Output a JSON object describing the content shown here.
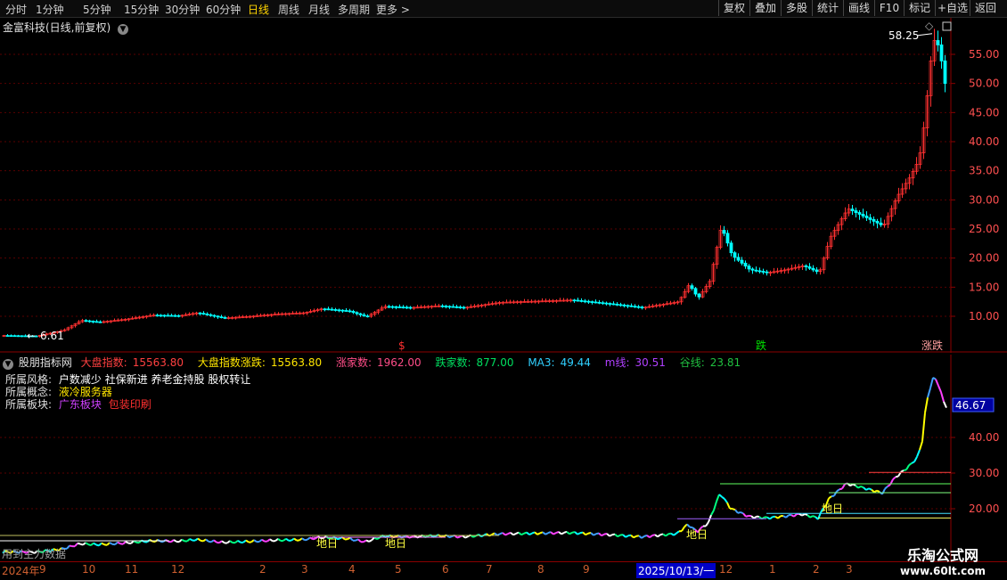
{
  "toolbar": {
    "periods": [
      "分时",
      "1分钟",
      "5分钟",
      "15分钟",
      "30分钟",
      "60分钟",
      "日线",
      "周线",
      "月线",
      "多周期",
      "更多 >"
    ],
    "active_period": "日线",
    "buttons": [
      "复权",
      "叠加",
      "多股",
      "统计",
      "画线",
      "F10",
      "标记",
      "+自选",
      "返回"
    ]
  },
  "main": {
    "stock_title": "金富科技(日线,前复权)",
    "y_ticks": [
      "55.00",
      "50.00",
      "45.00",
      "40.00",
      "35.00",
      "30.00",
      "25.00",
      "20.00",
      "15.00",
      "10.00"
    ],
    "high_label": "58.25",
    "low_label": "6.61",
    "markers": [
      {
        "text": "跌",
        "color": "#00e000"
      },
      {
        "text": "涨",
        "color": "#ff3030"
      },
      {
        "text": "涨跌",
        "color": "#ffa0a0"
      }
    ]
  },
  "indicator": {
    "name": "股朋指标网",
    "fields": [
      {
        "label": "大盘指数:",
        "value": "15563.80",
        "color": "#ff4040"
      },
      {
        "label": "大盘指数涨跌:",
        "value": "15563.80",
        "color": "#ffe600"
      },
      {
        "label": "涨家数:",
        "value": "1962.00",
        "color": "#ff4d88"
      },
      {
        "label": "跌家数:",
        "value": "877.00",
        "color": "#00e060"
      },
      {
        "label": "MA3:",
        "value": "49.44",
        "color": "#30d0ff"
      },
      {
        "label": "m线:",
        "value": "30.51",
        "color": "#b040ff"
      },
      {
        "label": "谷线:",
        "value": "23.81",
        "color": "#20c040"
      }
    ],
    "style_label": "所属风格:",
    "style_value": "户数减少 社保新进 养老金持股 股权转让",
    "concept_label": "所属概念:",
    "concept_value": "液冷服务器",
    "sector_label": "所属板块:",
    "sector_values": [
      "广东板块",
      "包装印刷"
    ],
    "y_ticks": [
      "40.00",
      "30.00",
      "20.00"
    ],
    "current_value": "46.67",
    "bottom_note": "用到主力数据",
    "tag": "地日"
  },
  "date_axis": {
    "labels": [
      "2024年",
      "9",
      "10",
      "11",
      "12",
      "2",
      "3",
      "4",
      "5",
      "6",
      "7",
      "8",
      "9",
      "12",
      "1",
      "2",
      "3"
    ],
    "cursor": "2025/10/13/一"
  },
  "watermark": {
    "line1": "乐淘公式网",
    "line2": "www.60lt.com"
  },
  "colors": {
    "up": "#ff3030",
    "down": "#00ffff",
    "grid": "#5a0000",
    "axis": "#8b0000"
  }
}
